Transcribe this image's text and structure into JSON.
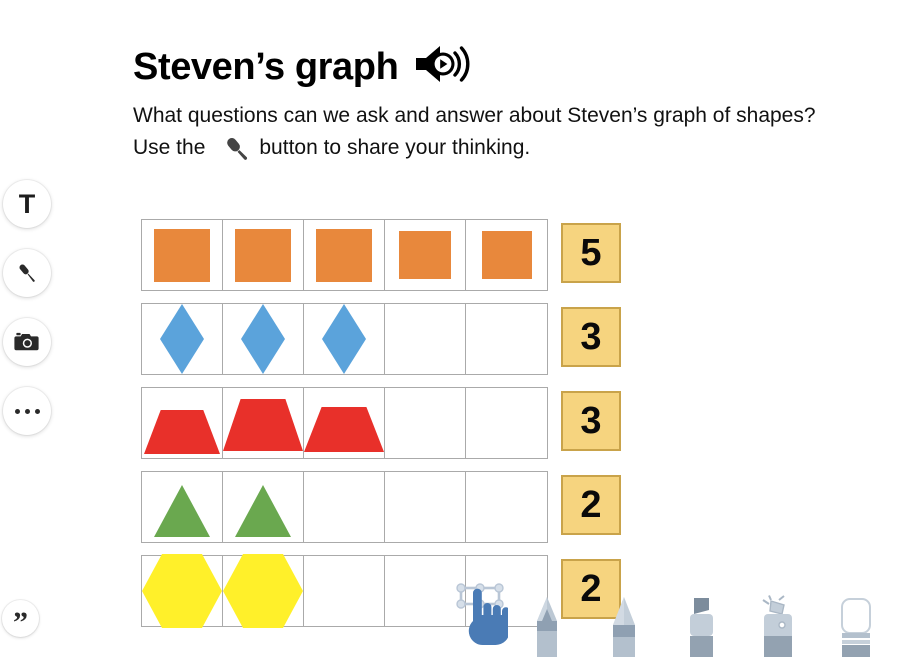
{
  "header": {
    "title": "Steven’s graph",
    "speaker_icon": "speaker-play-icon",
    "instruction_line1": "What questions can we ask and answer about Steven’s graph of shapes?",
    "instruction_line2_before": "Use the",
    "instruction_line2_after": "button to share your thinking.",
    "inline_icon": "microphone-icon"
  },
  "left_toolbar": {
    "items": [
      {
        "label": "T",
        "icon": "text-tool-icon",
        "name": "text"
      },
      {
        "label": "",
        "icon": "microphone-icon",
        "name": "microphone"
      },
      {
        "label": "",
        "icon": "camera-icon",
        "name": "camera"
      },
      {
        "label": "",
        "icon": "more-options-icon",
        "name": "more"
      }
    ],
    "quote": {
      "label": "”",
      "icon": "quote-icon"
    }
  },
  "bottom_toolbar": {
    "tools": [
      {
        "name": "hand-cursor",
        "icon": "hand-pointer-icon"
      },
      {
        "name": "pencil",
        "icon": "pencil-icon"
      },
      {
        "name": "pen",
        "icon": "pen-icon"
      },
      {
        "name": "marker",
        "icon": "marker-icon"
      },
      {
        "name": "spray",
        "icon": "spray-icon"
      },
      {
        "name": "eraser",
        "icon": "eraser-icon"
      }
    ]
  },
  "colors": {
    "orange": "#e8883c",
    "blue": "#5ba3db",
    "red": "#e8302a",
    "green": "#6aa84f",
    "yellow": "#fff02a",
    "badge_fill": "#f6d47f",
    "badge_border": "#c9a34a",
    "grid_line": "#aaaaaa",
    "cursor_blue": "#4a7bb5"
  },
  "chart_data": {
    "type": "bar",
    "title": "Steven’s graph",
    "orientation": "horizontal",
    "grid": true,
    "xlabel": "",
    "ylabel": "",
    "xlim": [
      0,
      5
    ],
    "columns": 5,
    "categories": [
      "square",
      "rhombus",
      "trapezoid",
      "triangle",
      "hexagon"
    ],
    "values": [
      5,
      3,
      3,
      2,
      2
    ],
    "rows": [
      {
        "shape": "square",
        "shape_class": "shape-square",
        "color": "#e8883c",
        "count": 5,
        "count_label": "5"
      },
      {
        "shape": "rhombus",
        "shape_class": "shape-diamond",
        "color": "#5ba3db",
        "count": 3,
        "count_label": "3"
      },
      {
        "shape": "trapezoid",
        "shape_class": "shape-trapezoid",
        "color": "#e8302a",
        "count": 3,
        "count_label": "3"
      },
      {
        "shape": "triangle",
        "shape_class": "shape-triangle",
        "color": "#6aa84f",
        "count": 2,
        "count_label": "2"
      },
      {
        "shape": "hexagon",
        "shape_class": "shape-hexagon",
        "color": "#fff02a",
        "count": 2,
        "count_label": "2"
      }
    ]
  }
}
